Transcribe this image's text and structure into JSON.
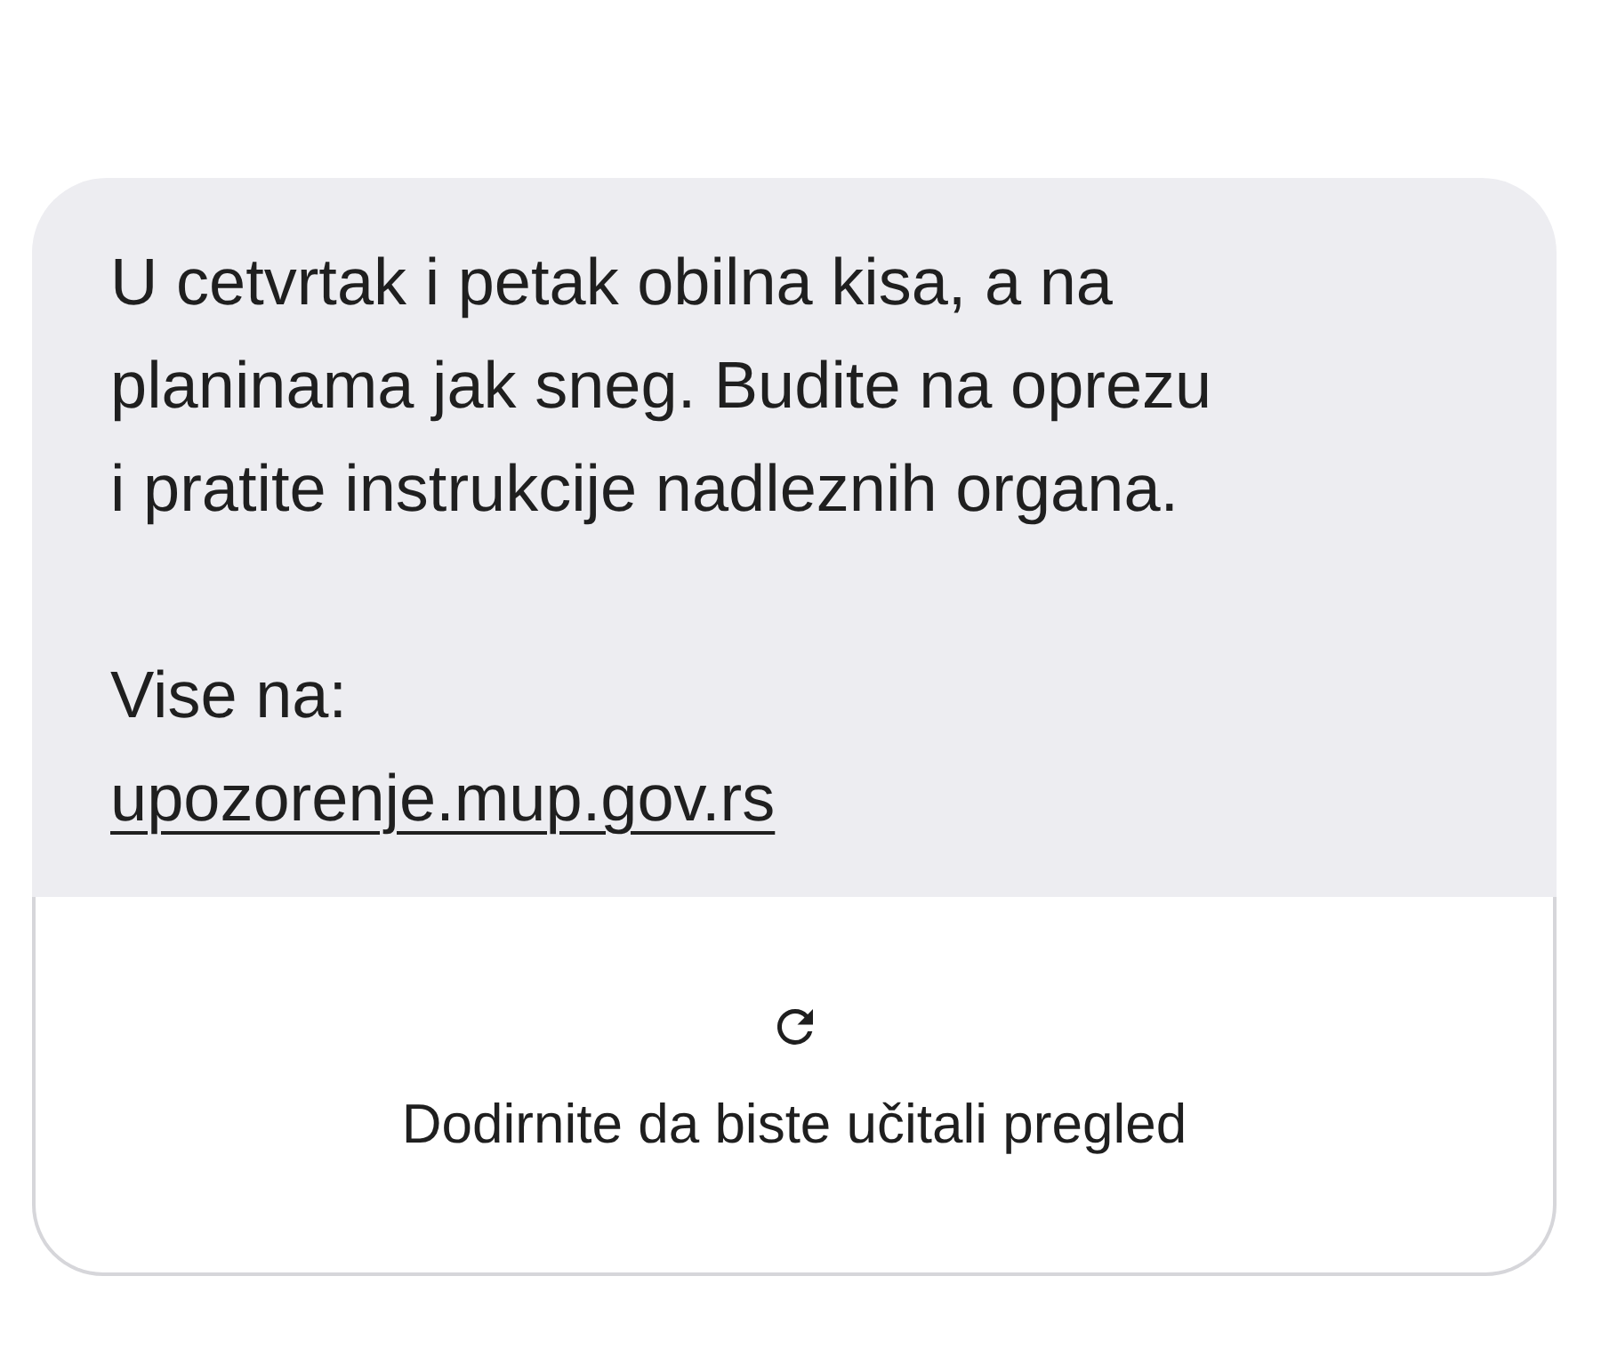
{
  "message": {
    "text": "U cetvrtak i petak obilna kisa, a na\nplaninama jak sneg. Budite na oprezu\ni pratite instrukcije nadleznih organa.",
    "more_label": "Vise na:",
    "link": "upozorenje.mup.gov.rs"
  },
  "link_preview": {
    "label": "Dodirnite da biste učitali pregled"
  }
}
